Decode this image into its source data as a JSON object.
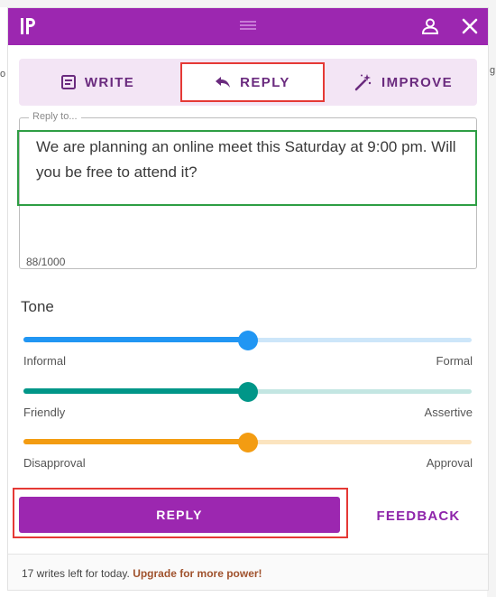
{
  "background": {
    "left_fragment": "o",
    "right_fragment": "g"
  },
  "header": {
    "brand": "IP",
    "color": "#9c27b0"
  },
  "tabs": [
    {
      "label": "WRITE",
      "icon": "document-icon"
    },
    {
      "label": "REPLY",
      "icon": "reply-arrow-icon",
      "active": true
    },
    {
      "label": "IMPROVE",
      "icon": "magic-wand-icon"
    }
  ],
  "reply_field": {
    "legend": "Reply to...",
    "text": "We are planning an online meet this Saturday at 9:00 pm. Will you be free to attend it?",
    "char_count": "88/1000"
  },
  "tone": {
    "label": "Tone",
    "sliders": [
      {
        "left": "Informal",
        "right": "Formal",
        "value": 0.5,
        "color": "#2196f3",
        "track": "#cde6f9"
      },
      {
        "left": "Friendly",
        "right": "Assertive",
        "value": 0.5,
        "color": "#009688",
        "track": "#c3e6e2"
      },
      {
        "left": "Disapproval",
        "right": "Approval",
        "value": 0.5,
        "color": "#f39c12",
        "track": "#fbe4bf"
      }
    ]
  },
  "actions": {
    "reply_label": "REPLY",
    "feedback_label": "FEEDBACK"
  },
  "footer": {
    "writes_left": "17 writes left for today.",
    "upgrade": "Upgrade for more power!"
  }
}
